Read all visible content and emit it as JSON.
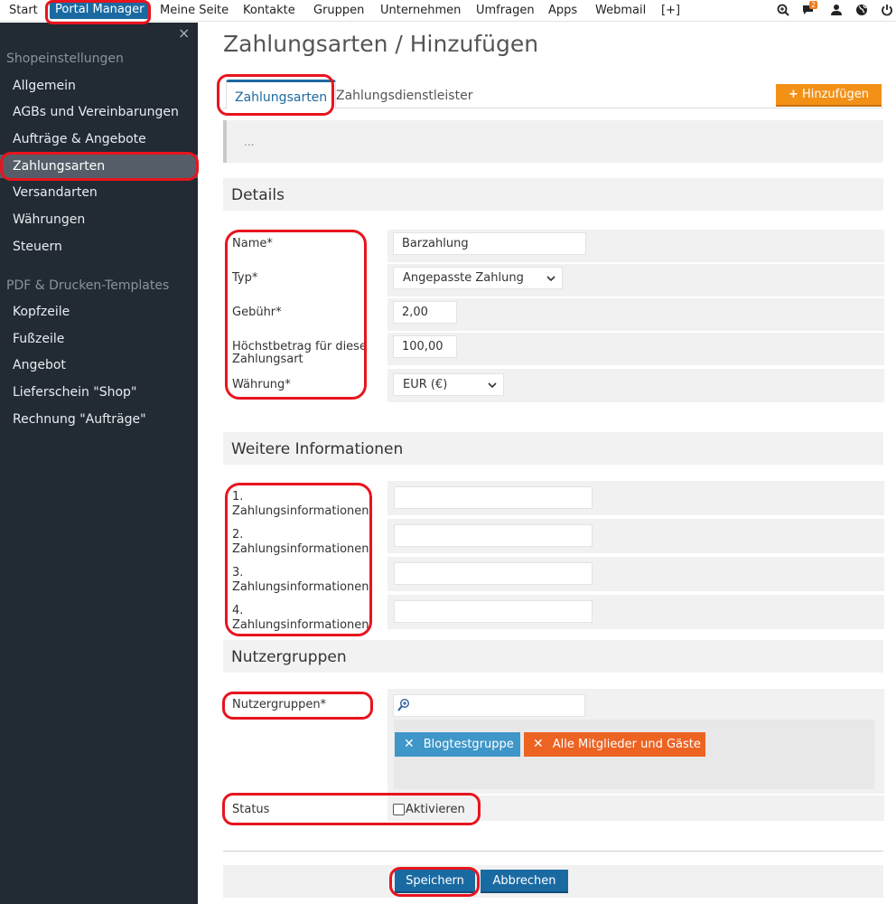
{
  "topnav": {
    "items": [
      "Start",
      "Portal Manager",
      "Meine Seite",
      "Kontakte",
      "Gruppen",
      "Unternehmen",
      "Umfragen",
      "Apps",
      "Webmail",
      "[+]"
    ],
    "active": "Portal Manager",
    "icons": [
      "search-plus-icon",
      "chat-icon",
      "user-icon",
      "globe-icon",
      "power-icon"
    ],
    "chat_badge": "2"
  },
  "sidebar": {
    "close_glyph": "×",
    "section1": "Shopeinstellungen",
    "items1": [
      "Allgemein",
      "AGBs und Vereinbarungen",
      "Aufträge & Angebote",
      "Zahlungsarten",
      "Versandarten",
      "Währungen",
      "Steuern"
    ],
    "section2": "PDF & Drucken-Templates",
    "items2": [
      "Kopfzeile",
      "Fußzeile",
      "Angebot",
      "Lieferschein \"Shop\"",
      "Rechnung \"Aufträge\""
    ],
    "active": "Zahlungsarten"
  },
  "page": {
    "title": "Zahlungsarten / Hinzufügen",
    "tabs": [
      "Zahlungsarten",
      "Zahlungsdienstleister"
    ],
    "add_button": "Hinzufügen",
    "description": "..."
  },
  "details": {
    "heading": "Details",
    "name_label": "Name*",
    "name_value": "Barzahlung",
    "type_label": "Typ*",
    "type_value": "Angepasste Zahlung",
    "fee_label": "Gebühr*",
    "fee_value": "2,00",
    "max_label_1": "Höchstbetrag für diese",
    "max_label_2": "Zahlungsart",
    "max_value": "100,00",
    "currency_label": "Währung*",
    "currency_value": "EUR (€)"
  },
  "more_info": {
    "heading": "Weitere Informationen",
    "labels": [
      [
        "1.",
        "Zahlungsinformationen"
      ],
      [
        "2.",
        "Zahlungsinformationen"
      ],
      [
        "3.",
        "Zahlungsinformationen"
      ],
      [
        "4.",
        "Zahlungsinformationen"
      ]
    ],
    "values": [
      "",
      "",
      "",
      ""
    ]
  },
  "user_groups": {
    "heading": "Nutzergruppen",
    "label": "Nutzergruppen*",
    "search_value": "",
    "tags": [
      "Blogtestgruppe",
      "Alle Mitglieder und Gäste"
    ],
    "tag_remove_glyph": "✕",
    "status_label": "Status",
    "activate_label": "Aktivieren",
    "activate_checked": false
  },
  "footer": {
    "save": "Speichern",
    "cancel": "Abbrechen"
  },
  "colors": {
    "nav_active": "#1a6aa2",
    "sidebar_bg": "#222a33",
    "add_button": "#f39117",
    "tag_blue": "#3f96c8",
    "tag_orange": "#ec6322",
    "highlight": "#e8141e"
  }
}
